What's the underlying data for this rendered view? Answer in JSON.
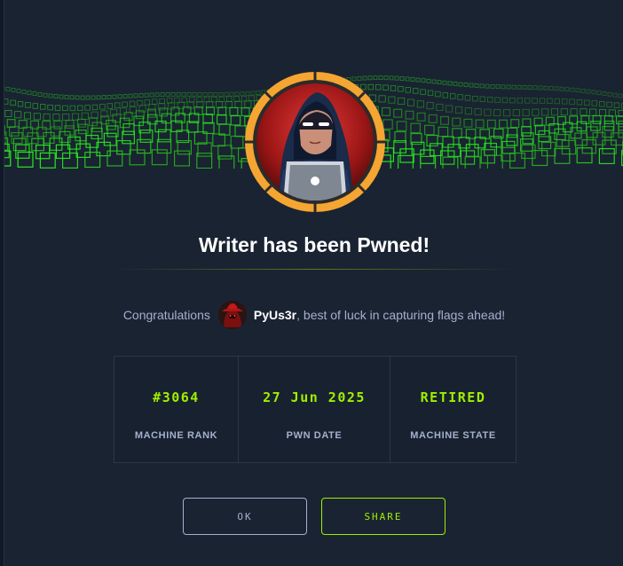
{
  "modal": {
    "title": "Writer has been Pwned!",
    "congrats_prefix": "Congratulations",
    "username": "PyUs3r",
    "congrats_suffix": ", best of luck in capturing flags ahead!",
    "user_avatar_icon": "hooded-hacker-avatar-icon",
    "machine_avatar_icon": "hooded-hacker-laptop-icon"
  },
  "stats": [
    {
      "value": "#3064",
      "label": "MACHINE RANK"
    },
    {
      "value": "27 Jun 2025",
      "label": "PWN DATE"
    },
    {
      "value": "RETIRED",
      "label": "MACHINE STATE"
    }
  ],
  "buttons": {
    "ok_label": "OK",
    "share_label": "SHARE"
  },
  "colors": {
    "accent_green": "#9fef00",
    "ring_orange": "#ffaf00",
    "background": "#1a2332",
    "muted_text": "#a4b1cd"
  }
}
